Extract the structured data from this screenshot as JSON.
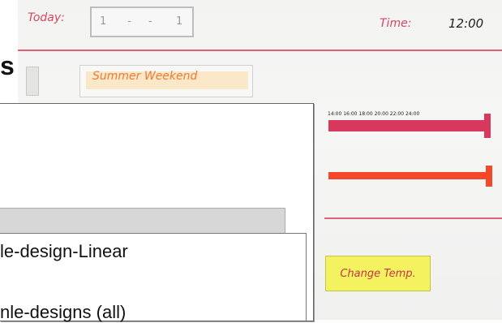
{
  "photo": {
    "today_label": "Today:",
    "date_parts": [
      "1",
      "-",
      "-",
      "1"
    ],
    "time_label": "Time:",
    "time_value": "12:00",
    "banner_text": "Summer Weekend",
    "timeline_ticks": "14:00  16:00  18:00  20:00  22:00  24:00",
    "change_temp_button": "Change Temp."
  },
  "window": {
    "title_fragment": "s",
    "list_items": [
      "le-design-Linear",
      "nle-designs (all)"
    ]
  },
  "colors": {
    "pink": "#d8375e",
    "orange": "#f3492a",
    "yellow": "#f4f35f"
  }
}
